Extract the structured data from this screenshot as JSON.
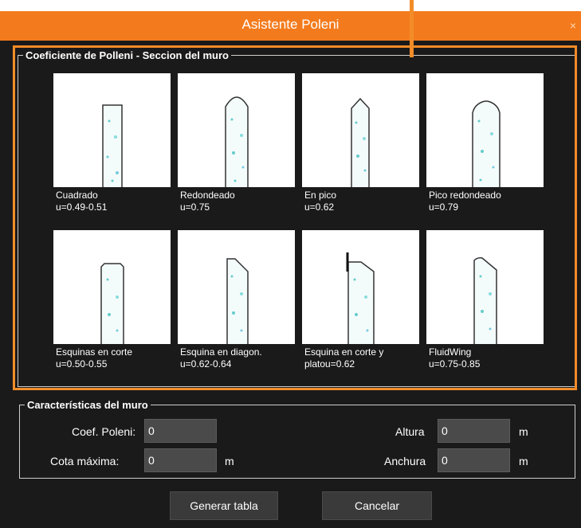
{
  "window": {
    "title": "Asistente Poleni",
    "close_glyph": "×"
  },
  "section_shapes": {
    "legend": "Coeficiente de Polleni - Seccion del muro",
    "shapes": [
      {
        "name": "Cuadrado",
        "coef": "u=0.49-0.51",
        "icon": "square-crest-icon"
      },
      {
        "name": "Redondeado",
        "coef": "u=0.75",
        "icon": "rounded-crest-icon"
      },
      {
        "name": "En pico",
        "coef": "u=0.62",
        "icon": "peaked-crest-icon"
      },
      {
        "name": "Pico redondeado",
        "coef": "u=0.79",
        "icon": "rounded-peak-crest-icon"
      },
      {
        "name": "Esquinas en corte",
        "coef": "u=0.50-0.55",
        "icon": "chamfered-corners-crest-icon"
      },
      {
        "name": "Esquina en diagon.",
        "coef": "u=0.62-0.64",
        "icon": "diagonal-corner-crest-icon"
      },
      {
        "name": "Esquina en corte y",
        "coef": "platou=0.62",
        "icon": "cut-corner-plateau-crest-icon"
      },
      {
        "name": "FluidWing",
        "coef": "u=0.75-0.85",
        "icon": "fluidwing-crest-icon"
      }
    ]
  },
  "wall": {
    "legend": "Características del muro",
    "coef_label": "Coef. Poleni:",
    "coef_value": "0",
    "cota_label": "Cota máxima:",
    "cota_value": "0",
    "cota_unit": "m",
    "altura_label": "Altura",
    "altura_value": "0",
    "altura_unit": "m",
    "anchura_label": "Anchura",
    "anchura_value": "0",
    "anchura_unit": "m"
  },
  "buttons": {
    "generate": "Generar tabla",
    "cancel": "Cancelar"
  },
  "colors": {
    "accent": "#f37b1d",
    "highlight": "#f28c28",
    "panel": "#1a1a1a",
    "input": "#4a4a4a"
  }
}
